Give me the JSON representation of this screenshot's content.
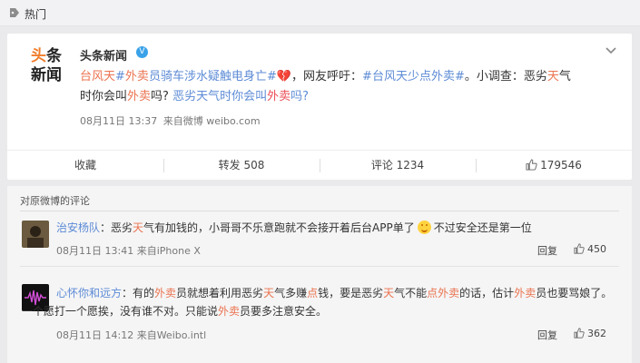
{
  "header": {
    "title": "热门"
  },
  "post": {
    "logo_line1_a": "头",
    "logo_line1_b": "条",
    "logo_line2": "新闻",
    "author": "头条新闻",
    "content_parts": {
      "t1": "台风天",
      "t2": "#",
      "t3": "外卖",
      "t4": "员骑车涉水疑触电身亡#",
      "t5": "💔",
      "t6": "，网友呼吁：",
      "t7": "#台风天少点外卖#",
      "t8": "。小调查：恶劣",
      "t9": "天",
      "t10": "气",
      "t11": "时你会叫",
      "t12": "外卖",
      "t13": "吗?",
      "t14": " 恶劣天气时你会叫",
      "t15": "外卖",
      "t16": "吗?"
    },
    "date": "08月11日 13:37",
    "source_prefix": "来自",
    "source": "微博 weibo.com",
    "actions": {
      "favorite": "收藏",
      "repost": "转发 508",
      "comment": "评论 1234",
      "like": "179546"
    }
  },
  "comments_section": {
    "title": "对原微博的评论",
    "items": [
      {
        "name": "治安杨队",
        "text_a": "：恶劣",
        "text_b": "天",
        "text_c": "气有加钱的，小哥哥不乐意跑就不会接开着后台APP单了",
        "text_d": "不过安全还是第一位",
        "date": "08月11日 13:41",
        "source": "来自iPhone X",
        "reply": "回复",
        "likes": "450"
      },
      {
        "name": "心怀你和远方",
        "text_a": "：有的",
        "text_b": "外卖",
        "text_c": "员就想着利用恶劣",
        "text_d": "天",
        "text_e": "气多赚",
        "text_f": "点",
        "text_g": "钱，要是恶劣",
        "text_h": "天",
        "text_i": "气不能",
        "text_j": "点外卖",
        "text_k": "的话，估计",
        "text_l": "外卖",
        "text_m": "员也要骂娘了。",
        "text_n": "一个愿打一个愿挨，没有谁不对。只能说",
        "text_o": "外卖",
        "text_p": "员要多注意安全。",
        "date": "08月11日 14:12",
        "source": "来自Weibo.intl",
        "reply": "回复",
        "likes": "362"
      }
    ]
  },
  "colors": {
    "highlight": "#eb7350",
    "topic": "#5d8bd6",
    "link_name": "#5d8bd6",
    "verified": "#3aa2e8"
  }
}
